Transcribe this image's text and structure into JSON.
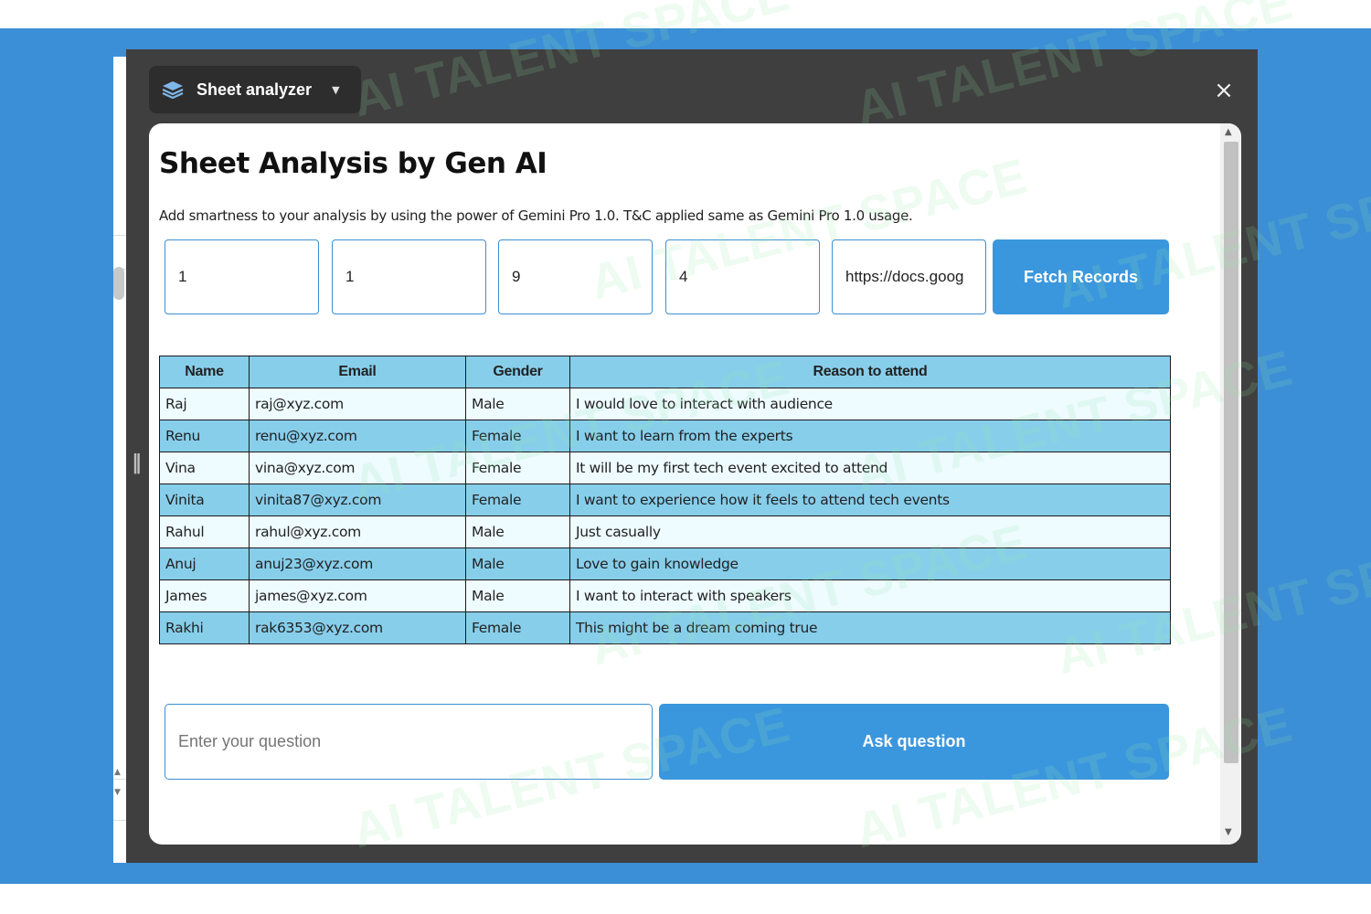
{
  "panel": {
    "title": "Sheet analyzer",
    "title_icon": "layers-icon",
    "close_label": "×"
  },
  "page": {
    "heading": "Sheet Analysis by Gen AI",
    "subtitle": "Add smartness to your analysis by using the power of Gemini Pro 1.0. T&C applied same as Gemini Pro 1.0 usage."
  },
  "inputs": {
    "fields": [
      "1",
      "1",
      "9",
      "4",
      "https://docs.goog"
    ],
    "fetch_label": "Fetch Records"
  },
  "table": {
    "headers": [
      "Name",
      "Email",
      "Gender",
      "Reason to attend"
    ],
    "rows": [
      [
        "Raj",
        "raj@xyz.com",
        "Male",
        "I would love to interact with audience"
      ],
      [
        "Renu",
        "renu@xyz.com",
        "Female",
        "I want to learn from the experts"
      ],
      [
        "Vina",
        "vina@xyz.com",
        "Female",
        "It will be my first tech event excited to attend"
      ],
      [
        "Vinita",
        "vinita87@xyz.com",
        "Female",
        "I want to experience how it feels to attend tech events"
      ],
      [
        "Rahul",
        "rahul@xyz.com",
        "Male",
        "Just casually"
      ],
      [
        "Anuj",
        "anuj23@xyz.com",
        "Male",
        "Love to gain knowledge"
      ],
      [
        "James",
        "james@xyz.com",
        "Male",
        "I want to interact with speakers"
      ],
      [
        "Rakhi",
        "rak6353@xyz.com",
        "Female",
        "This might be a dream coming true"
      ]
    ]
  },
  "question": {
    "placeholder": "Enter your question",
    "ask_label": "Ask question"
  },
  "watermark": {
    "text": "AI TALENT SPACE"
  },
  "colors": {
    "background_blue": "#3b8fd6",
    "panel_dark": "#3f3f3f",
    "button_blue": "#3b97dd",
    "row_dark": "#87ceeb",
    "row_light": "#eefbff"
  }
}
